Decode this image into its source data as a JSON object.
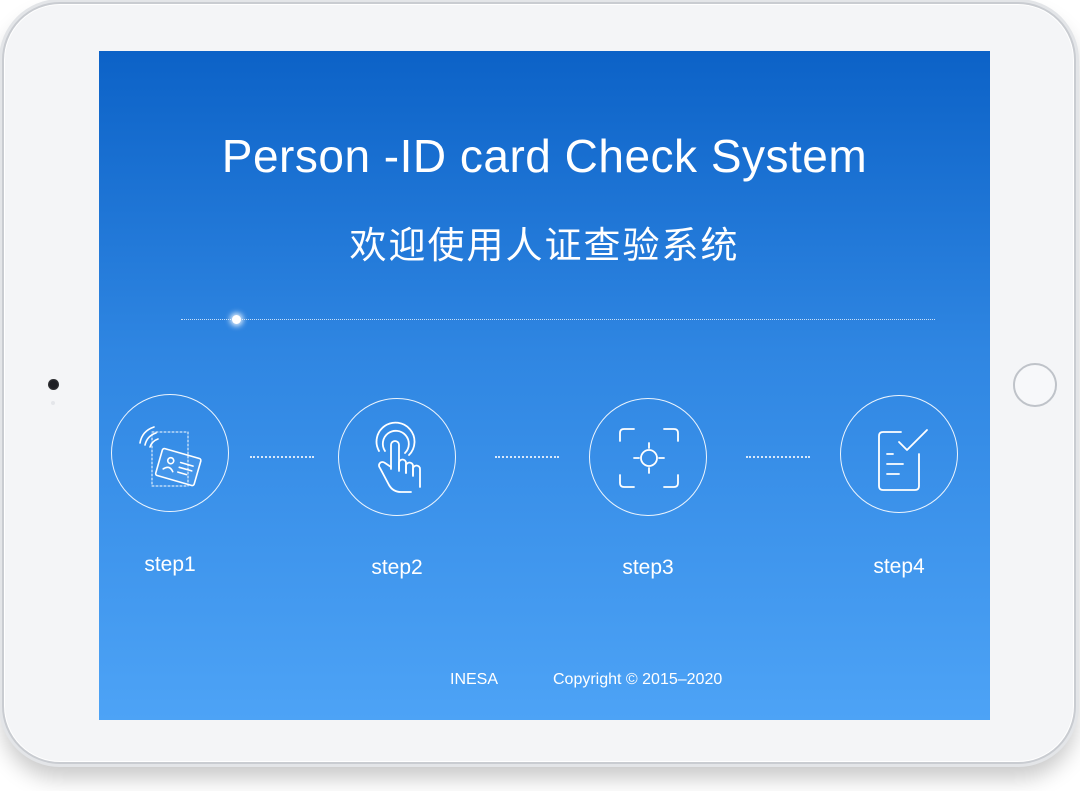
{
  "app": {
    "title": "Person -ID card Check System",
    "subtitle": "欢迎使用人证查验系统"
  },
  "steps": [
    {
      "label": "step1",
      "icon": "id-card-nfc-icon"
    },
    {
      "label": "step2",
      "icon": "touch-finger-icon"
    },
    {
      "label": "step3",
      "icon": "face-scan-icon"
    },
    {
      "label": "step4",
      "icon": "checklist-document-icon"
    }
  ],
  "footer": {
    "company": "INESA",
    "copyright": "Copyright © 2015–2020"
  },
  "colors": {
    "screen_top": "#0c62c7",
    "screen_bottom": "#4da3f6",
    "foreground": "#ffffff"
  }
}
